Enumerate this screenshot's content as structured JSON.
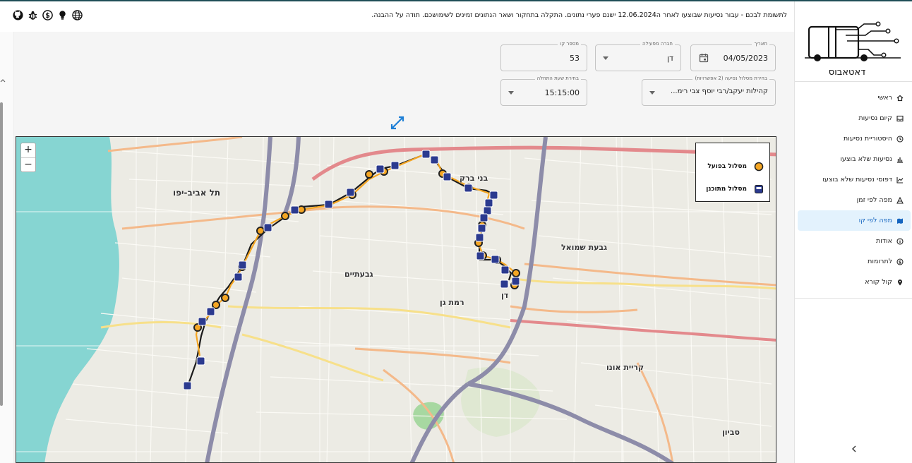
{
  "topbar": {
    "message": "לתשומת לבכם - עבור נסיעות שבוצעו לאחר ה12.06.2024 ישנם פערי נתונים. התקלה בתחקור ושאר הנתונים זמינים לשימושכם. תודה על ההבנה.",
    "icons": [
      "github-icon",
      "bug-icon",
      "dollar-icon",
      "lightbulb-icon",
      "globe-icon"
    ]
  },
  "sidebar": {
    "logo_text": "דאטאבוס",
    "items": [
      {
        "label": "ראשי",
        "icon": "home-icon"
      },
      {
        "label": "קיום נסיעות",
        "icon": "inbox-icon"
      },
      {
        "label": "היסטוריית נסיעות",
        "icon": "history-icon"
      },
      {
        "label": "נסיעות שלא בוצעו",
        "icon": "bar-chart-icon"
      },
      {
        "label": "דפוסי נסיעות שלא בוצעו",
        "icon": "line-chart-icon"
      },
      {
        "label": "מפה לפי זמן",
        "icon": "radar-icon"
      },
      {
        "label": "מפה לפי קו",
        "icon": "map-icon"
      },
      {
        "label": "אודות",
        "icon": "info-icon"
      },
      {
        "label": "לתרומות",
        "icon": "donate-icon"
      },
      {
        "label": "קול קורא",
        "icon": "pin-icon"
      }
    ],
    "active_index": 6
  },
  "filters": {
    "date": {
      "label": "תאריך",
      "value": "04/05/2023"
    },
    "operator": {
      "label": "חברה מפעילה",
      "value": "דן"
    },
    "line": {
      "label": "מספר קו",
      "value": "53"
    },
    "route": {
      "label": "בחירת מסלול נסיעה (2 אפשרויות)",
      "value": "קהילות יעקב/רבי יוסף צבי רימ..."
    },
    "time": {
      "label": "בחירת שעת התחלה",
      "value": "15:15:00"
    }
  },
  "map": {
    "zoom_in": "+",
    "zoom_out": "−",
    "legend": {
      "actual": "מסלול בפועל",
      "planned": "מסלול מתוכנן"
    },
    "places": {
      "tlv": "תל אביב-יפו",
      "bnei_brak": "בני ברק",
      "givatayim": "גבעתיים",
      "ramat_gan": "רמת גן",
      "givat_shmuel": "גבעת שמואל",
      "kiryat_ono": "קריית אונו",
      "savyon": "סביון",
      "dan": "דן"
    },
    "colors": {
      "actual": "#f5a623",
      "planned": "#222222",
      "stop_planned": "#2b3a8f",
      "sea": "#7dd3d3",
      "highway": "#8b8aa8",
      "rail": "#e07c7c"
    }
  }
}
